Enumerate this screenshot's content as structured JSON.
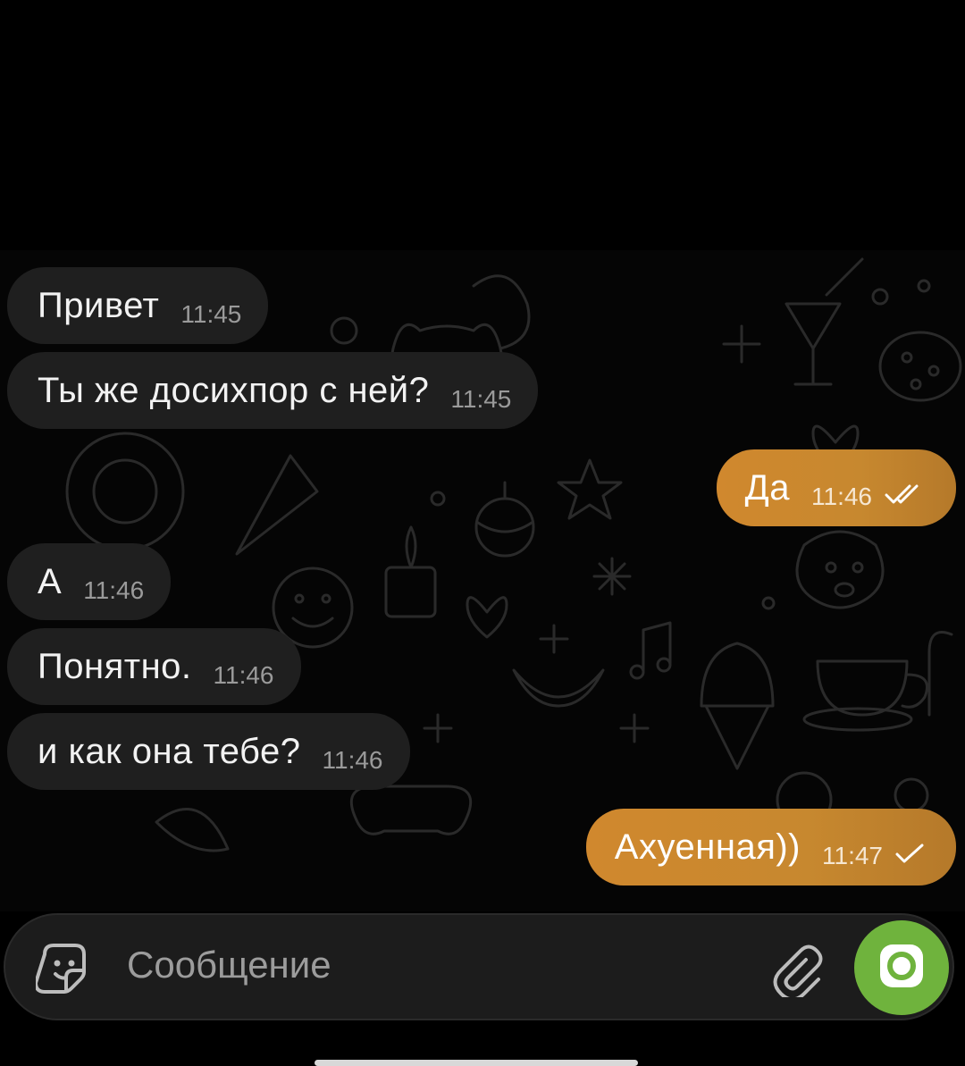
{
  "messages": [
    {
      "direction": "in",
      "text": "Привет",
      "time": "11:45"
    },
    {
      "direction": "in",
      "text": "Ты же досихпор с ней?",
      "time": "11:45"
    },
    {
      "direction": "out",
      "text": "Да",
      "time": "11:46",
      "status": "read"
    },
    {
      "direction": "in",
      "text": "А",
      "time": "11:46"
    },
    {
      "direction": "in",
      "text": "Понятно.",
      "time": "11:46"
    },
    {
      "direction": "in",
      "text": "и как она тебе?",
      "time": "11:46"
    },
    {
      "direction": "out",
      "text": "Ахуенная))",
      "time": "11:47",
      "status": "sent"
    }
  ],
  "composer": {
    "placeholder": "Сообщение",
    "left_icon": "sticker-icon",
    "attach_icon": "paperclip-icon",
    "action_icon": "camera-icon"
  },
  "colors": {
    "incoming_bubble": "#1f1f1f",
    "outgoing_bubble": "#d0882e",
    "action_button": "#6fb33d",
    "background": "#000000"
  }
}
